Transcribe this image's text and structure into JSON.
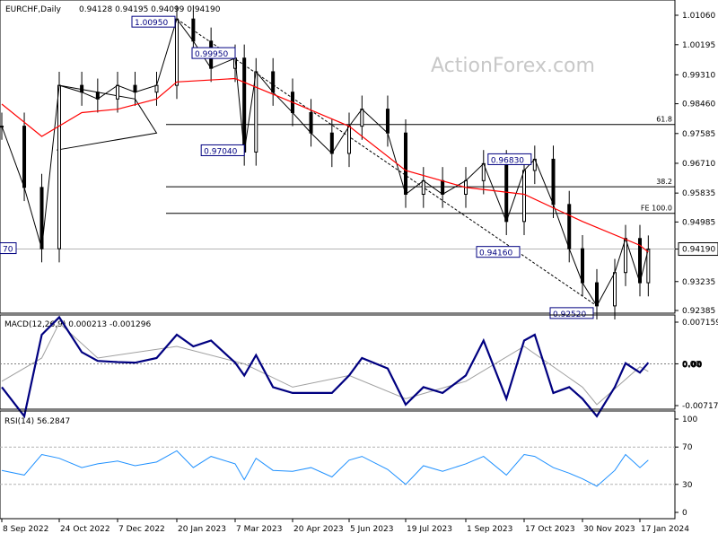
{
  "header": {
    "symbol": "EURCHF,Daily",
    "ohlc": "0.94128 0.94195 0.94099 0.94190",
    "macd_label": "MACD(12,26,9) 0.000213 -0.001296",
    "rsi_label": "RSI(14) 56.2847"
  },
  "watermark": "ActionForex.com",
  "colors": {
    "price": "#000000",
    "ma": "#ff0000",
    "macd": "#000080",
    "signal": "#a0a0a0",
    "rsi": "#1e90ff",
    "level": "#000000",
    "last_price_label_bg": "#ffffff"
  },
  "chart_data": [
    {
      "type": "candlestick",
      "title": "EURCHF,Daily",
      "x_tick_labels": [
        "8 Sep 2022",
        "24 Oct 2022",
        "7 Dec 2022",
        "20 Jan 2023",
        "7 Mar 2023",
        "20 Apr 2023",
        "5 Jun 2023",
        "19 Jul 2023",
        "1 Sep 2023",
        "17 Oct 2023",
        "30 Nov 2023",
        "17 Jan 2024"
      ],
      "y_tick_labels": [
        "1.01060",
        "1.00195",
        "0.99310",
        "0.98460",
        "0.97585",
        "0.96710",
        "0.95835",
        "0.94985",
        "0.94190",
        "0.93235",
        "0.92385"
      ],
      "ylim": [
        0.9225,
        1.0125
      ],
      "last_price": "0.94190",
      "series": [
        {
          "name": "EURCHF",
          "x": [
            "8 Sep 2022",
            "26 Sep 2022",
            "10 Oct 2022",
            "24 Oct 2022",
            "10 Nov 2022",
            "22 Nov 2022",
            "7 Dec 2022",
            "20 Dec 2022",
            "5 Jan 2023",
            "20 Jan 2023",
            "2 Feb 2023",
            "16 Feb 2023",
            "7 Mar 2023",
            "14 Mar 2023",
            "23 Mar 2023",
            "5 Apr 2023",
            "20 Apr 2023",
            "5 May 2023",
            "22 May 2023",
            "5 Jun 2023",
            "15 Jun 2023",
            "5 Jul 2023",
            "19 Jul 2023",
            "1 Aug 2023",
            "15 Aug 2023",
            "1 Sep 2023",
            "15 Sep 2023",
            "3 Oct 2023",
            "17 Oct 2023",
            "25 Oct 2023",
            "8 Nov 2023",
            "20 Nov 2023",
            "30 Nov 2023",
            "12 Dec 2023",
            "27 Dec 2023",
            "5 Jan 2024",
            "17 Jan 2024",
            "24 Jan 2024"
          ],
          "y": [
            0.978,
            0.96,
            0.942,
            0.99,
            0.988,
            0.986,
            0.99,
            0.988,
            0.99,
            1.0095,
            1.003,
            0.995,
            0.998,
            0.9704,
            0.994,
            0.988,
            0.982,
            0.976,
            0.97,
            0.978,
            0.983,
            0.976,
            0.958,
            0.962,
            0.958,
            0.962,
            0.967,
            0.95,
            0.965,
            0.9683,
            0.955,
            0.942,
            0.932,
            0.9252,
            0.935,
            0.945,
            0.932,
            0.9419
          ]
        },
        {
          "name": "Moving average",
          "x": [
            "8 Sep 2022",
            "10 Oct 2022",
            "10 Nov 2022",
            "7 Dec 2022",
            "5 Jan 2023",
            "20 Jan 2023",
            "7 Mar 2023",
            "20 Apr 2023",
            "5 Jun 2023",
            "19 Jul 2023",
            "1 Sep 2023",
            "17 Oct 2023",
            "30 Nov 2023",
            "17 Jan 2024",
            "24 Jan 2024"
          ],
          "y": [
            0.9845,
            0.975,
            0.982,
            0.983,
            0.986,
            0.991,
            0.992,
            0.985,
            0.978,
            0.965,
            0.96,
            0.958,
            0.95,
            0.943,
            0.941
          ]
        }
      ],
      "annotations": [
        {
          "label": "1.00950",
          "x": "20 Jan 2023",
          "y": 1.0095
        },
        {
          "label": "0.99950",
          "x": "7 Mar 2023",
          "y": 0.9995
        },
        {
          "label": "0.97040",
          "x": "14 Mar 2023",
          "y": 0.9704
        },
        {
          "label": "0.96830",
          "x": "25 Oct 2023",
          "y": 0.9683
        },
        {
          "label": "0.94160",
          "x": "1 Sep 2023",
          "y": 0.9416
        },
        {
          "label": "0.92520",
          "x": "12 Dec 2023",
          "y": 0.9252
        },
        {
          "label": "70",
          "x": "8 Sep 2022",
          "y": 0.9419
        }
      ],
      "levels": [
        {
          "label": "61.8",
          "y": 0.9785
        },
        {
          "label": "38.2",
          "y": 0.9602
        },
        {
          "label": "FE 100.0",
          "y": 0.9524
        },
        {
          "label": "",
          "y": 0.9419
        }
      ]
    },
    {
      "type": "line",
      "title": "MACD(12,26,9) 0.000213 -0.001296",
      "y_tick_labels": [
        "0.007159",
        "0.00",
        "-0.007173"
      ],
      "right_values": [
        "0.00",
        "0.00"
      ],
      "ylim": [
        -0.0095,
        0.0085
      ],
      "series": [
        {
          "name": "MACD",
          "x": [
            "8 Sep 2022",
            "26 Sep 2022",
            "10 Oct 2022",
            "24 Oct 2022",
            "10 Nov 2022",
            "22 Nov 2022",
            "7 Dec 2022",
            "20 Dec 2022",
            "5 Jan 2023",
            "20 Jan 2023",
            "2 Feb 2023",
            "16 Feb 2023",
            "7 Mar 2023",
            "14 Mar 2023",
            "23 Mar 2023",
            "5 Apr 2023",
            "20 Apr 2023",
            "5 May 2023",
            "22 May 2023",
            "5 Jun 2023",
            "15 Jun 2023",
            "5 Jul 2023",
            "19 Jul 2023",
            "1 Aug 2023",
            "15 Aug 2023",
            "1 Sep 2023",
            "15 Sep 2023",
            "3 Oct 2023",
            "17 Oct 2023",
            "25 Oct 2023",
            "8 Nov 2023",
            "20 Nov 2023",
            "30 Nov 2023",
            "12 Dec 2023",
            "27 Dec 2023",
            "5 Jan 2024",
            "17 Jan 2024",
            "24 Jan 2024"
          ],
          "y": [
            -0.004,
            -0.009,
            0.005,
            0.008,
            0.002,
            0.0005,
            0.0003,
            0.0002,
            0.001,
            0.005,
            0.003,
            0.004,
            0.0002,
            -0.002,
            0.0015,
            -0.004,
            -0.005,
            -0.005,
            -0.005,
            -0.002,
            0.001,
            -0.0008,
            -0.007,
            -0.004,
            -0.005,
            -0.002,
            0.004,
            -0.006,
            0.004,
            0.005,
            -0.005,
            -0.004,
            -0.006,
            -0.009,
            -0.004,
            0.0001,
            -0.0015,
            0.0002
          ]
        },
        {
          "name": "Signal",
          "x": [
            "8 Sep 2022",
            "10 Oct 2022",
            "24 Oct 2022",
            "22 Nov 2022",
            "20 Jan 2023",
            "14 Mar 2023",
            "20 Apr 2023",
            "5 Jun 2023",
            "19 Jul 2023",
            "1 Sep 2023",
            "17 Oct 2023",
            "30 Nov 2023",
            "12 Dec 2023",
            "17 Jan 2024",
            "24 Jan 2024"
          ],
          "y": [
            -0.003,
            0.001,
            0.007,
            0.001,
            0.003,
            0.0,
            -0.004,
            -0.002,
            -0.006,
            -0.003,
            0.003,
            -0.004,
            -0.007,
            -0.0005,
            -0.0013
          ]
        }
      ]
    },
    {
      "type": "line",
      "title": "RSI(14) 56.2847",
      "y_tick_labels": [
        "100",
        "70",
        "30",
        "0"
      ],
      "ylim": [
        0,
        100
      ],
      "series": [
        {
          "name": "RSI",
          "x": [
            "8 Sep 2022",
            "26 Sep 2022",
            "10 Oct 2022",
            "24 Oct 2022",
            "10 Nov 2022",
            "22 Nov 2022",
            "7 Dec 2022",
            "20 Dec 2022",
            "5 Jan 2023",
            "20 Jan 2023",
            "2 Feb 2023",
            "16 Feb 2023",
            "7 Mar 2023",
            "14 Mar 2023",
            "23 Mar 2023",
            "5 Apr 2023",
            "20 Apr 2023",
            "5 May 2023",
            "22 May 2023",
            "5 Jun 2023",
            "15 Jun 2023",
            "5 Jul 2023",
            "19 Jul 2023",
            "1 Aug 2023",
            "15 Aug 2023",
            "1 Sep 2023",
            "15 Sep 2023",
            "3 Oct 2023",
            "17 Oct 2023",
            "25 Oct 2023",
            "8 Nov 2023",
            "20 Nov 2023",
            "30 Nov 2023",
            "12 Dec 2023",
            "27 Dec 2023",
            "5 Jan 2024",
            "17 Jan 2024",
            "24 Jan 2024"
          ],
          "y": [
            45,
            40,
            62,
            58,
            48,
            52,
            55,
            50,
            54,
            66,
            48,
            60,
            52,
            35,
            58,
            45,
            44,
            48,
            38,
            56,
            60,
            46,
            30,
            50,
            44,
            52,
            60,
            40,
            62,
            60,
            48,
            42,
            36,
            28,
            45,
            62,
            48,
            56
          ]
        }
      ]
    }
  ]
}
